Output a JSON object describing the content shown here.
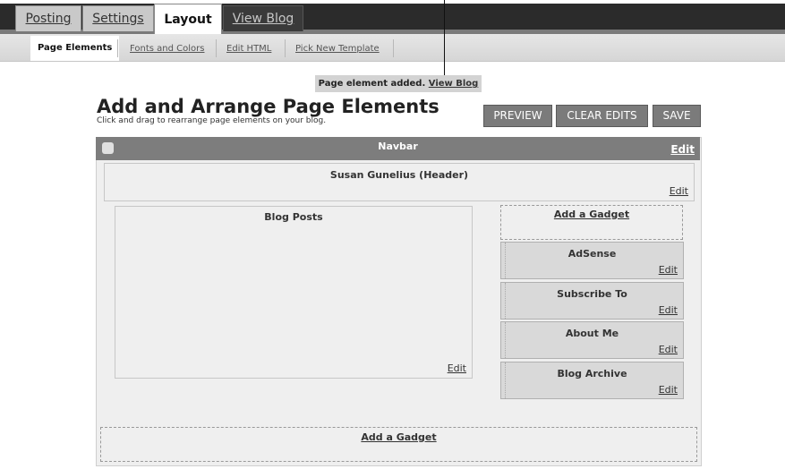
{
  "tabs": {
    "posting": "Posting",
    "settings": "Settings",
    "layout": "Layout",
    "view_blog": "View Blog"
  },
  "subtabs": {
    "page_elements": "Page Elements",
    "fonts_colors": "Fonts and Colors",
    "edit_html": "Edit HTML",
    "pick_template": "Pick New Template"
  },
  "notice": {
    "text": "Page element added.",
    "link": "View Blog"
  },
  "page": {
    "title": "Add and Arrange Page Elements",
    "subtitle": "Click and drag to rearrange page elements on your blog."
  },
  "buttons": {
    "preview": "PREVIEW",
    "clear_edits": "CLEAR EDITS",
    "save": "SAVE"
  },
  "navbar": {
    "label": "Navbar",
    "edit": "Edit"
  },
  "header": {
    "label": "Susan Gunelius (Header)",
    "edit": "Edit"
  },
  "main": {
    "blog_posts": "Blog Posts",
    "edit": "Edit"
  },
  "sidebar": {
    "add_gadget": "Add a Gadget",
    "gadgets": [
      {
        "label": "AdSense",
        "edit": "Edit"
      },
      {
        "label": "Subscribe To",
        "edit": "Edit"
      },
      {
        "label": "About Me",
        "edit": "Edit"
      },
      {
        "label": "Blog Archive",
        "edit": "Edit"
      }
    ]
  },
  "footer": {
    "add_gadget": "Add a Gadget"
  }
}
